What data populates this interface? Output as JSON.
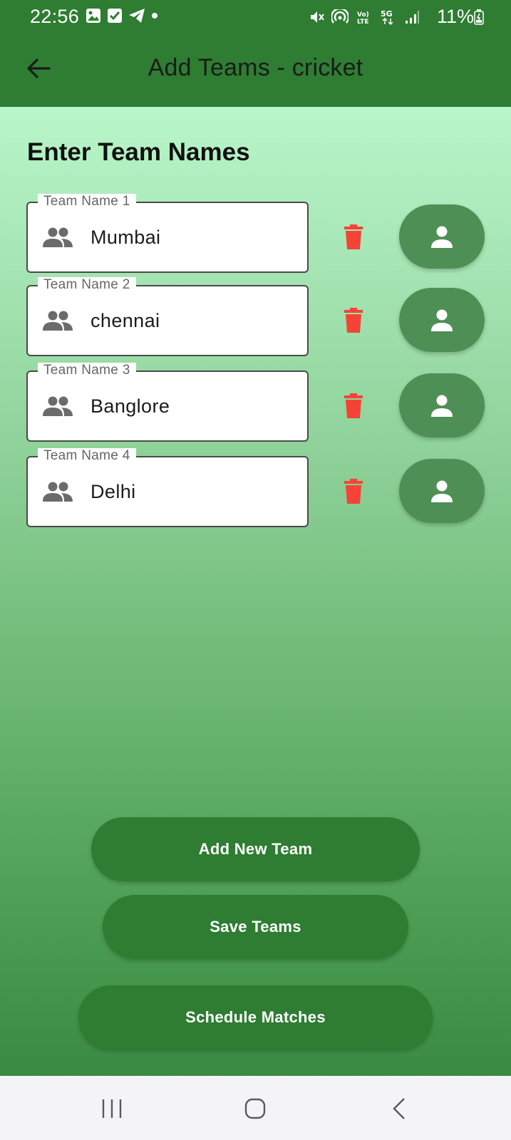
{
  "status_bar": {
    "time": "22:56",
    "battery_percent": "11%",
    "network": "5G"
  },
  "app_bar": {
    "title": "Add Teams - cricket",
    "back_icon": "arrow-back-icon"
  },
  "page": {
    "heading": "Enter Team Names"
  },
  "teams": [
    {
      "label": "Team Name 1",
      "value": "Mumbai"
    },
    {
      "label": "Team Name 2",
      "value": "chennai"
    },
    {
      "label": "Team Name 3",
      "value": "Banglore"
    },
    {
      "label": "Team Name 4",
      "value": "Delhi"
    }
  ],
  "actions": {
    "add_new_team": "Add New Team",
    "save_teams": "Save Teams",
    "schedule_matches": "Schedule Matches"
  },
  "colors": {
    "primary": "#2e7d32",
    "delete": "#f44336",
    "player_button": "#4e8f55",
    "gradient_top": "#b9f6ca",
    "gradient_bottom": "#3a8b41"
  },
  "icons": {
    "field": "group-icon",
    "delete": "trash-icon",
    "player": "person-icon"
  }
}
